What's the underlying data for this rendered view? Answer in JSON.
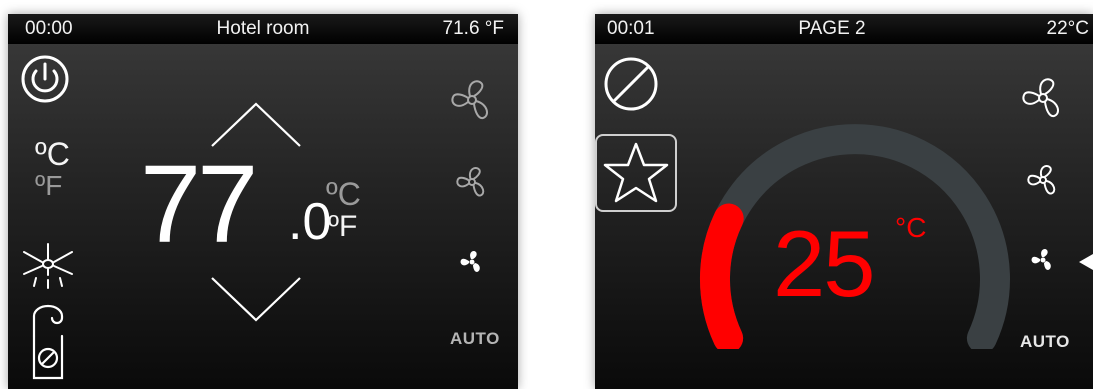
{
  "screen1": {
    "status": {
      "time": "00:00",
      "title": "Hotel room",
      "temperature": "71.6 °F"
    },
    "units": {
      "celsius": "ºC",
      "fahrenheit": "ºF"
    },
    "setpoint": {
      "integer": "77",
      "decimal": ".0"
    },
    "unit_toggle": {
      "celsius": "ºC",
      "fahrenheit": "ºF"
    },
    "fan_auto_label": "AUTO",
    "icons": [
      "power-icon",
      "ceiling-fan-icon",
      "door-hanger-icon",
      "fan-icon"
    ]
  },
  "screen2": {
    "status": {
      "time": "00:01",
      "title": "PAGE 2",
      "temperature": "22°C"
    },
    "setpoint": {
      "value": "25",
      "unit": "°C"
    },
    "gauge_level_fraction": 0.22,
    "fan_auto_label": "AUTO",
    "icons": [
      "prohibited-icon",
      "star-icon",
      "fan-icon"
    ]
  },
  "colors": {
    "setpoint_red": "#ff0000",
    "gauge_track": "#3a4043",
    "icon_white": "#ffffff",
    "icon_gray": "#a8a8a8"
  }
}
